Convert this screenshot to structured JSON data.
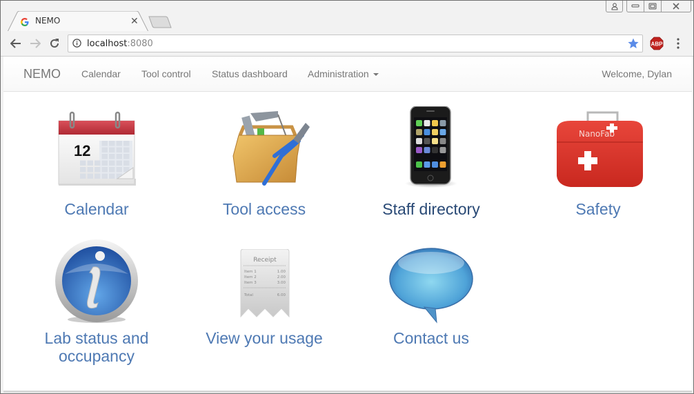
{
  "browser": {
    "tab_title": "NEMO",
    "url_host": "localhost",
    "url_port": ":8080",
    "icons": {
      "favicon": "google-g-icon",
      "close": "close-icon",
      "back": "back-arrow-icon",
      "forward": "forward-arrow-icon",
      "reload": "reload-icon",
      "info": "info-icon",
      "bookmark": "star-icon",
      "extension": "adblock-plus-icon",
      "menu": "kebab-menu-icon"
    },
    "extension_label": "ABP",
    "accent_star": "#5a8be8"
  },
  "navbar": {
    "brand": "NEMO",
    "links": [
      {
        "label": "Calendar"
      },
      {
        "label": "Tool control"
      },
      {
        "label": "Status dashboard"
      },
      {
        "label": "Administration",
        "dropdown": true
      }
    ],
    "welcome": "Welcome, Dylan"
  },
  "tiles": [
    {
      "label": "Calendar",
      "icon": "calendar-icon",
      "calendar_day": "12"
    },
    {
      "label": "Tool access",
      "icon": "toolbox-icon"
    },
    {
      "label": "Staff directory",
      "icon": "smartphone-icon",
      "hovered": true
    },
    {
      "label": "Safety",
      "icon": "first-aid-kit-icon",
      "kit_text": "NanoFab"
    },
    {
      "label_line1": "Lab status and",
      "label_line2": "occupancy",
      "icon": "info-icon"
    },
    {
      "label": "View your usage",
      "icon": "receipt-icon",
      "receipt": {
        "title": "Receipt",
        "rows": [
          [
            "Item 1",
            "1.00"
          ],
          [
            "Item 2",
            "2.00"
          ],
          [
            "Item 3",
            "3.00"
          ]
        ],
        "total_label": "Total",
        "total_value": "6.00"
      }
    },
    {
      "label": "Contact us",
      "icon": "speech-bubble-icon"
    }
  ],
  "colors": {
    "link": "#4e79b3",
    "link_hover": "#2a4a76",
    "nav_text": "#777777"
  }
}
